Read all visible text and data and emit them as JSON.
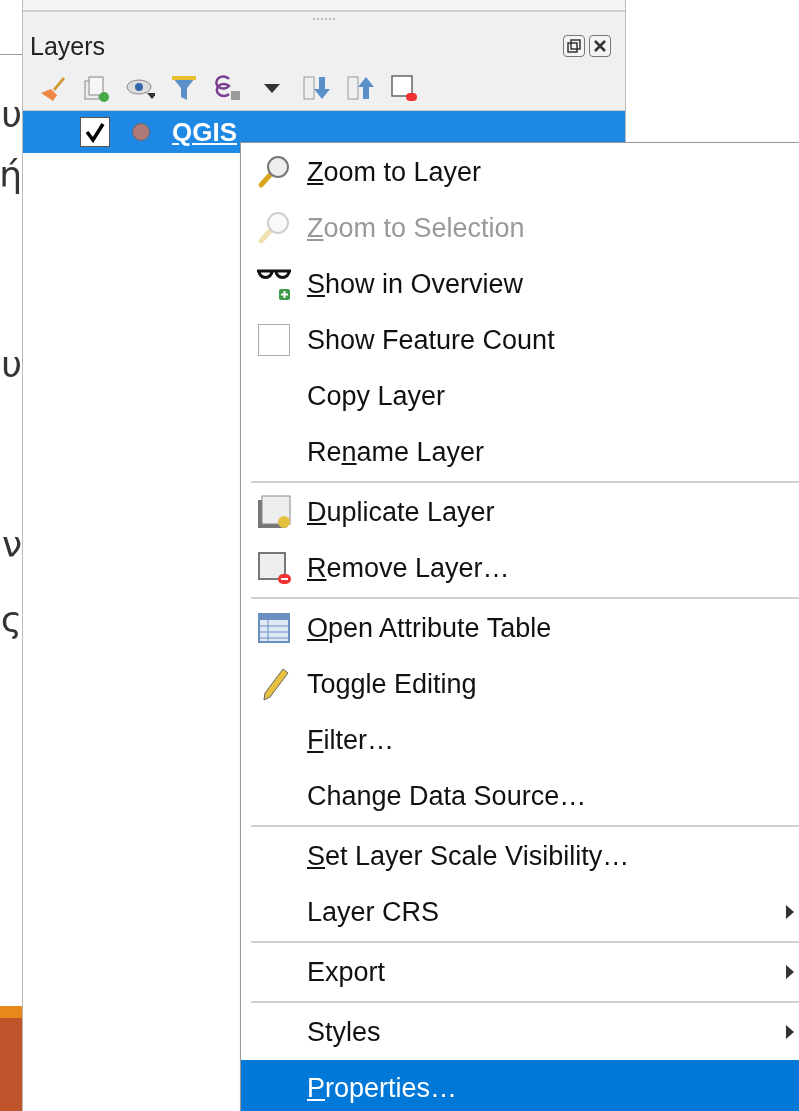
{
  "slide_fragments": [
    "υ",
    "ή",
    "υ",
    "ν",
    "ς"
  ],
  "layers_panel": {
    "title": "Layers",
    "layers": [
      {
        "name": "QGIS",
        "checked": true,
        "selected": true,
        "color": "#b07a7a"
      }
    ]
  },
  "context_menu": {
    "items": [
      {
        "kind": "action",
        "access_key": "Z",
        "label_rest": "oom to Layer",
        "disabled": false,
        "selected": false
      },
      {
        "kind": "action",
        "access_key": "Z",
        "label_rest": "oom to Selection",
        "disabled": true,
        "selected": false
      },
      {
        "kind": "action",
        "access_key": "S",
        "label_rest": "how in Overview",
        "disabled": false,
        "selected": false
      },
      {
        "kind": "check",
        "label": "Show Feature Count",
        "checked": false,
        "disabled": false,
        "selected": false
      },
      {
        "kind": "action",
        "label": "Copy Layer",
        "disabled": false,
        "selected": false
      },
      {
        "kind": "action",
        "label_start": "Re",
        "access_key": "n",
        "label_rest": "ame Layer",
        "disabled": false,
        "selected": false
      },
      {
        "kind": "separator"
      },
      {
        "kind": "action",
        "access_key": "D",
        "label_rest": "uplicate Layer",
        "disabled": false,
        "selected": false
      },
      {
        "kind": "action",
        "access_key": "R",
        "label_rest": "emove Layer…",
        "disabled": false,
        "selected": false
      },
      {
        "kind": "separator"
      },
      {
        "kind": "action",
        "access_key": "O",
        "label_rest": "pen Attribute Table",
        "disabled": false,
        "selected": false
      },
      {
        "kind": "action",
        "label": "Toggle Editing",
        "disabled": false,
        "selected": false
      },
      {
        "kind": "action",
        "access_key": "F",
        "label_rest": "ilter…",
        "disabled": false,
        "selected": false
      },
      {
        "kind": "action",
        "label": "Change Data Source…",
        "disabled": false,
        "selected": false
      },
      {
        "kind": "separator"
      },
      {
        "kind": "action",
        "access_key": "S",
        "label_rest": "et Layer Scale Visibility…",
        "disabled": false,
        "selected": false
      },
      {
        "kind": "submenu",
        "label": "Layer CRS",
        "disabled": false,
        "selected": false
      },
      {
        "kind": "separator"
      },
      {
        "kind": "submenu",
        "label": "Export",
        "disabled": false,
        "selected": false
      },
      {
        "kind": "separator"
      },
      {
        "kind": "submenu",
        "label": "Styles",
        "disabled": false,
        "selected": false
      },
      {
        "kind": "action",
        "access_key": "P",
        "label_rest": "roperties…",
        "disabled": false,
        "selected": true
      }
    ]
  }
}
